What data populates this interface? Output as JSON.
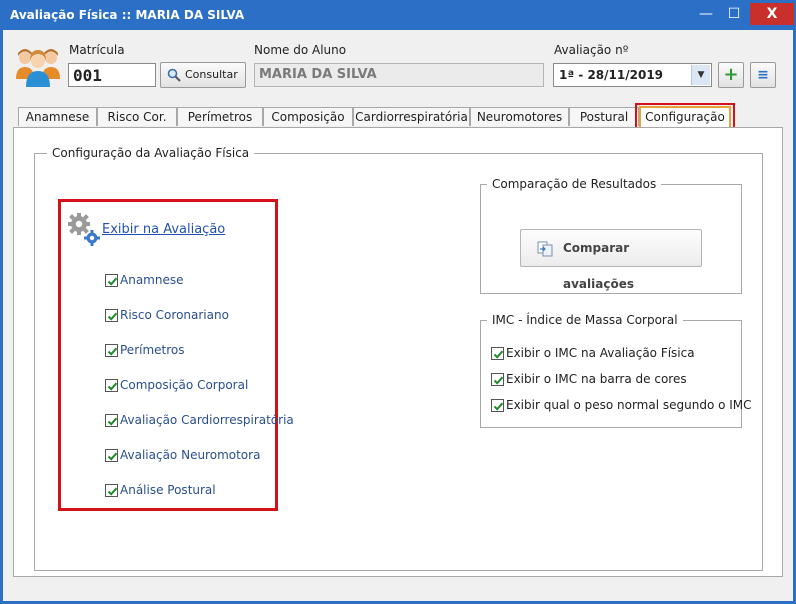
{
  "window": {
    "title": "Avaliação Física  ::  MARIA DA SILVA",
    "minimize_glyph": "—",
    "maximize_glyph": "☐",
    "close_glyph": "X"
  },
  "header": {
    "matricula_label": "Matrícula",
    "matricula_value": "001",
    "consultar_label": "Consultar",
    "nome_label": "Nome do Aluno",
    "nome_value": "MARIA DA SILVA",
    "avaliacao_label": "Avaliação nº",
    "avaliacao_value": "1ª - 28/11/2019",
    "add_glyph": "+",
    "menu_glyph": "≡"
  },
  "tabs": [
    {
      "label": "Anamnese"
    },
    {
      "label": "Risco Cor."
    },
    {
      "label": "Perímetros"
    },
    {
      "label": "Composição"
    },
    {
      "label": "Cardiorrespiratória"
    },
    {
      "label": "Neuromotores"
    },
    {
      "label": "Postural"
    },
    {
      "label": "Configuração",
      "active": true
    }
  ],
  "config": {
    "group_title": "Configuração da Avaliação Física",
    "exibir_link": "Exibir na Avaliação",
    "items": [
      {
        "label": "Anamnese",
        "checked": true
      },
      {
        "label": "Risco Coronariano",
        "checked": true
      },
      {
        "label": "Perímetros",
        "checked": true
      },
      {
        "label": "Composição Corporal",
        "checked": true
      },
      {
        "label": "Avaliação Cardiorrespiratória",
        "checked": true
      },
      {
        "label": "Avaliação Neuromotora",
        "checked": true
      },
      {
        "label": "Análise Postural",
        "checked": true
      }
    ]
  },
  "comparacao": {
    "title": "Comparação de Resultados",
    "button_label": "Comparar avaliações"
  },
  "imc": {
    "title": "IMC - Índice de Massa Corporal",
    "items": [
      {
        "label": "Exibir o IMC na Avaliação Física",
        "checked": true
      },
      {
        "label": "Exibir o IMC na barra de cores",
        "checked": true
      },
      {
        "label": "Exibir qual o peso normal segundo o IMC",
        "checked": true
      }
    ]
  },
  "colors": {
    "accent": "#2b6fc7",
    "close": "#c9302c",
    "highlight": "#d4101a",
    "active_tab_border": "#e6a33a",
    "link": "#2250b6",
    "check": "#1f8a2a"
  }
}
